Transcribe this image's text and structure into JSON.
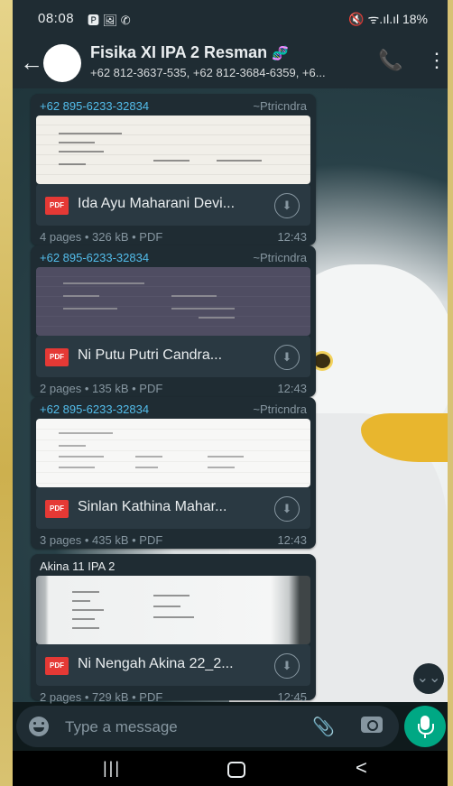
{
  "status_bar": {
    "time": "08:08",
    "notif_icons": "🅿 🖼 ✆",
    "right": "🔇 ᯤ.ıl.ıl 18%"
  },
  "header": {
    "back_glyph": "←",
    "title": "Fisika XI IPA 2 Resman",
    "title_emoji": "🧬",
    "subtitle": "+62 812-3637-535, +62 812-3684-6359, +6...",
    "call_glyph": "📞",
    "more_glyph": "⋮"
  },
  "messages": [
    {
      "sender": "+62 895-6233-32834",
      "alias": "~Ptricndra",
      "file_name": "Ida Ayu Maharani Devi...",
      "meta": "4 pages • 326 kB • PDF",
      "time": "12:43"
    },
    {
      "sender": "+62 895-6233-32834",
      "alias": "~Ptricndra",
      "file_name": "Ni Putu Putri Candra...",
      "meta": "2 pages • 135 kB • PDF",
      "time": "12:43"
    },
    {
      "sender": "+62 895-6233-32834",
      "alias": "~Ptricndra",
      "file_name": "Sinlan Kathina Mahar...",
      "meta": "3 pages • 435 kB • PDF",
      "time": "12:43"
    },
    {
      "sender": "Akina 11 IPA 2",
      "alias": "",
      "file_name": "Ni Nengah Akina 22_2...",
      "meta": "2 pages • 729 kB • PDF",
      "time": "12:45"
    }
  ],
  "pdf_label": "PDF",
  "download_glyph": "⬇",
  "scroll_down_glyph": "⌄⌄",
  "input": {
    "placeholder": "Type a message",
    "attach_glyph": "📎"
  },
  "nav": {
    "recents": "|||",
    "back": "<"
  },
  "colors": {
    "accent": "#00a884",
    "bubble": "#1f2c33",
    "sender": "#53bdeb",
    "pdf": "#e53935"
  }
}
